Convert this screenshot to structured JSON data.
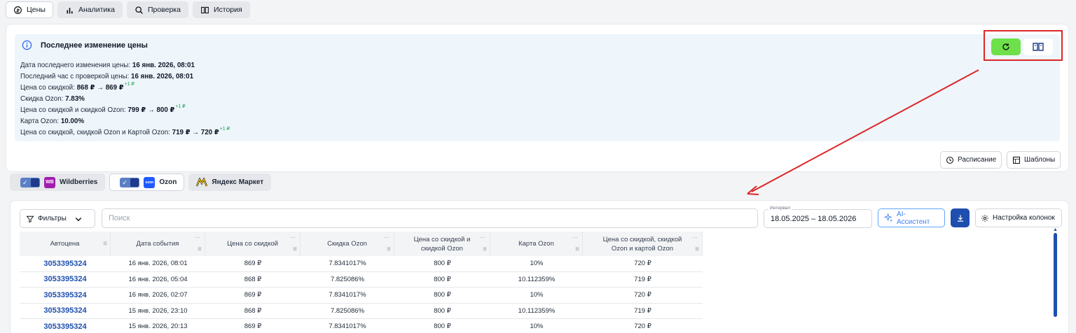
{
  "top_tabs": [
    {
      "label": "Цены",
      "icon": "refresh-coins-icon",
      "active": true
    },
    {
      "label": "Аналитика",
      "icon": "bar-chart-icon",
      "active": false
    },
    {
      "label": "Проверка",
      "icon": "search-icon",
      "active": false
    },
    {
      "label": "История",
      "icon": "book-icon",
      "active": false
    }
  ],
  "price_info": {
    "title": "Последнее изменение цены",
    "lines": [
      {
        "label": "Дата последнего изменения цены:",
        "value": "16 янв. 2026, 08:01",
        "delta": ""
      },
      {
        "label": "Последний час с проверкой цены:",
        "value": "16 янв. 2026, 08:01",
        "delta": ""
      },
      {
        "label": "Цена со скидкой:",
        "value": "868 ₽ → 869 ₽",
        "delta": "+1 ₽"
      },
      {
        "label": "Скидка Ozon:",
        "value": "7.83%",
        "delta": ""
      },
      {
        "label": "Цена со скидкой и скидкой Ozon:",
        "value": "799 ₽ → 800 ₽",
        "delta": "+1 ₽"
      },
      {
        "label": "Карта Ozon:",
        "value": "10.00%",
        "delta": ""
      },
      {
        "label": "Цена со скидкой, скидкой Ozon и Картой Ozon:",
        "value": "719 ₽ → 720 ₽",
        "delta": "+1 ₽"
      }
    ]
  },
  "toolbar": {
    "schedule_label": "Расписание",
    "templates_label": "Шаблоны"
  },
  "marketplaces": [
    {
      "label": "Wildberries",
      "logo": "WB",
      "color": "#a31caf",
      "active": false
    },
    {
      "label": "Ozon",
      "logo": "ozon",
      "color": "#1e5bff",
      "active": true
    },
    {
      "label": "Яндекс Маркет",
      "logo": "ym",
      "color": "#ffcc00",
      "active": false
    }
  ],
  "table_toolbar": {
    "filters_label": "Фильтры",
    "search_placeholder": "Поиск",
    "interval_label": "Интервал",
    "interval_value": "18.05.2025 – 18.05.2026",
    "ai_label": "AI-Ассистент",
    "columns_label": "Настройка колонок"
  },
  "table": {
    "columns": [
      "Автоцена",
      "Дата события",
      "Цена со скидкой",
      "Скидка Ozon",
      "Цена со скидкой и скидкой Ozon",
      "Карта Ozon",
      "Цена со скидкой, скидкой Ozon и картой Ozon"
    ],
    "rows": [
      [
        "3053395324",
        "16 янв. 2026, 08:01",
        "869 ₽",
        "7.8341017%",
        "800 ₽",
        "10%",
        "720 ₽"
      ],
      [
        "3053395324",
        "16 янв. 2026, 05:04",
        "868 ₽",
        "7.825086%",
        "800 ₽",
        "10.112359%",
        "719 ₽"
      ],
      [
        "3053395324",
        "16 янв. 2026, 02:07",
        "869 ₽",
        "7.8341017%",
        "800 ₽",
        "10%",
        "720 ₽"
      ],
      [
        "3053395324",
        "15 янв. 2026, 23:10",
        "868 ₽",
        "7.825086%",
        "800 ₽",
        "10.112359%",
        "719 ₽"
      ],
      [
        "3053395324",
        "15 янв. 2026, 20:13",
        "869 ₽",
        "7.8341017%",
        "800 ₽",
        "10%",
        "720 ₽"
      ]
    ]
  },
  "colors": {
    "accent": "#1e4fae",
    "highlight": "#dc2626",
    "green": "#6ee04a"
  }
}
